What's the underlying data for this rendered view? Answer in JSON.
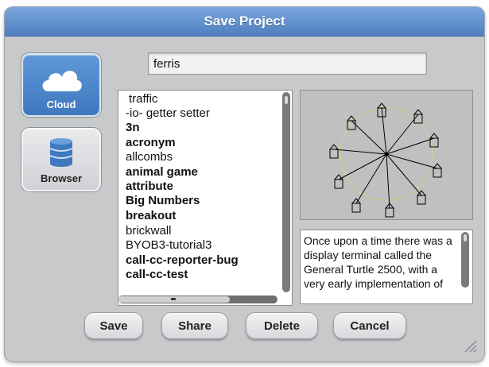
{
  "dialog": {
    "title": "Save Project"
  },
  "sources": [
    {
      "label": "Cloud",
      "icon": "cloud-icon",
      "selected": true
    },
    {
      "label": "Browser",
      "icon": "database-icon",
      "selected": false
    }
  ],
  "project_name": {
    "value": "ferris"
  },
  "project_list": {
    "items": [
      {
        "label": "traffic",
        "bold": false
      },
      {
        "label": "-io- getter setter",
        "bold": false
      },
      {
        "label": "3n",
        "bold": true
      },
      {
        "label": "acronym",
        "bold": true
      },
      {
        "label": "allcombs",
        "bold": false
      },
      {
        "label": "animal game",
        "bold": true
      },
      {
        "label": "attribute",
        "bold": true
      },
      {
        "label": "Big Numbers",
        "bold": true
      },
      {
        "label": "breakout",
        "bold": true
      },
      {
        "label": "brickwall",
        "bold": false
      },
      {
        "label": "BYOB3-tutorial3",
        "bold": false
      },
      {
        "label": "call-cc-reporter-bug",
        "bold": true
      },
      {
        "label": "call-cc-test",
        "bold": true
      }
    ]
  },
  "preview": {
    "thumbnail": "ferris-wheel-thumbnail"
  },
  "notes": {
    "lines": [
      "Once upon a time there was a",
      "display terminal called the",
      "General Turtle 2500, with a",
      "very early implementation of"
    ]
  },
  "buttons": {
    "save": "Save",
    "share": "Share",
    "delete": "Delete",
    "cancel": "Cancel"
  },
  "colors": {
    "title_bar": "#5a8bca",
    "dialog_bg": "#c8c9cb",
    "accent": "#4a82c4"
  }
}
